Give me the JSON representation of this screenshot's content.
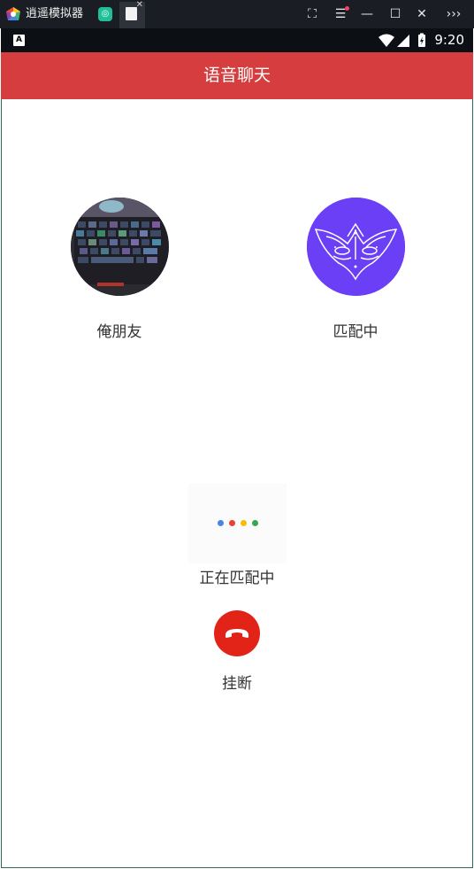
{
  "emulator": {
    "title": "逍遥模拟器",
    "tab2_close": "✕",
    "controls": {
      "screenshot": "⛶",
      "menu": "☰",
      "minimize": "—",
      "maximize": "☐",
      "close": "✕",
      "more": "›››"
    }
  },
  "status_bar": {
    "notification_letter": "A",
    "time": "9:20"
  },
  "app_bar": {
    "title": "语音聊天"
  },
  "call": {
    "left_user": {
      "name": "俺朋友",
      "avatar": "keyboard-photo"
    },
    "right_user": {
      "name": "匹配中",
      "avatar": "masquerade-mask"
    },
    "status_text": "正在匹配中",
    "hangup_label": "挂断"
  },
  "colors": {
    "app_bar": "#d63d3f",
    "hangup": "#e12417",
    "right_avatar_bg": "#6a3ff5",
    "loader_dots": [
      "#4a86e8",
      "#e94235",
      "#fbbc05",
      "#34a853"
    ]
  }
}
